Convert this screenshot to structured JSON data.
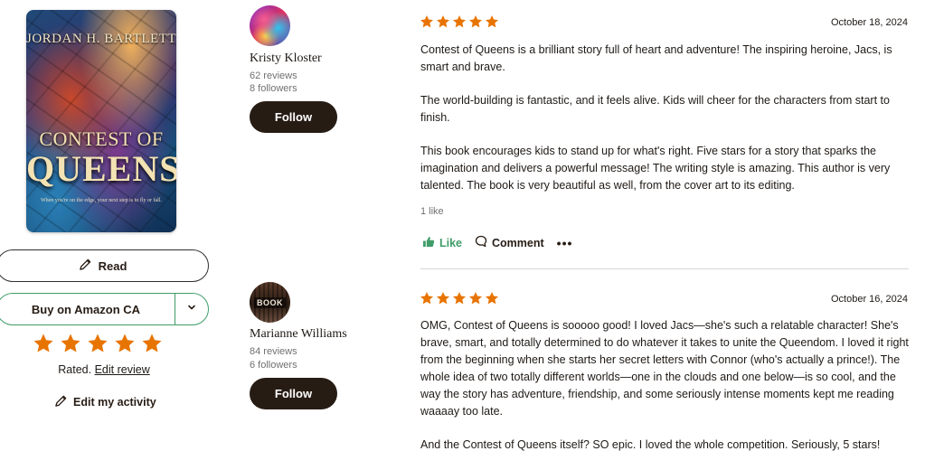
{
  "book": {
    "cover_author": "JORDAN H. BARTLETT",
    "cover_title_line1": "CONTEST OF",
    "cover_title_line2": "QUEENS",
    "cover_tagline": "When you're on the edge, your next step is to fly or fall."
  },
  "shelf": {
    "read_label": "Read",
    "buy_label": "Buy on Amazon CA",
    "rating_stars": 5,
    "star_color": "#e87400",
    "rated_text": "Rated.",
    "edit_review_link": "Edit review",
    "edit_activity_label": "Edit my activity"
  },
  "reviews": [
    {
      "reviewer": {
        "name": "Kristy Kloster",
        "reviews": "62 reviews",
        "followers": "8 followers",
        "follow_label": "Follow"
      },
      "stars": 5,
      "date": "October 18, 2024",
      "paragraphs": [
        "Contest of Queens is a brilliant story full of heart and adventure! The inspiring heroine, Jacs, is smart and brave.",
        "The world-building is fantastic, and it feels alive. Kids will cheer for the characters from start to finish.",
        "This book encourages kids to stand up for what's right. Five stars for a story that sparks the imagination and delivers a powerful message! The writing style is amazing. This author is very talented. The book is very beautiful as well, from the cover art to its editing."
      ],
      "likes": "1 like",
      "like_label": "Like",
      "comment_label": "Comment",
      "more_label": "•••"
    },
    {
      "reviewer": {
        "name": "Marianne Williams",
        "reviews": "84 reviews",
        "followers": "6 followers",
        "follow_label": "Follow",
        "avatar_text": "BOOK"
      },
      "stars": 5,
      "date": "October 16, 2024",
      "paragraphs": [
        "OMG, Contest of Queens is sooooo good! I loved Jacs—she's such a relatable character! She's brave, smart, and totally determined to do whatever it takes to unite the Queendom. I loved it right from the beginning when she starts her secret letters with Connor (who's actually a prince!). The whole idea of two totally different worlds—one in the clouds and one below—is so cool, and the way the story has adventure, friendship, and some seriously intense moments kept me reading waaaay too late.",
        "And the Contest of Queens itself? SO epic. I loved the whole competition. Seriously, 5 stars!"
      ]
    }
  ]
}
